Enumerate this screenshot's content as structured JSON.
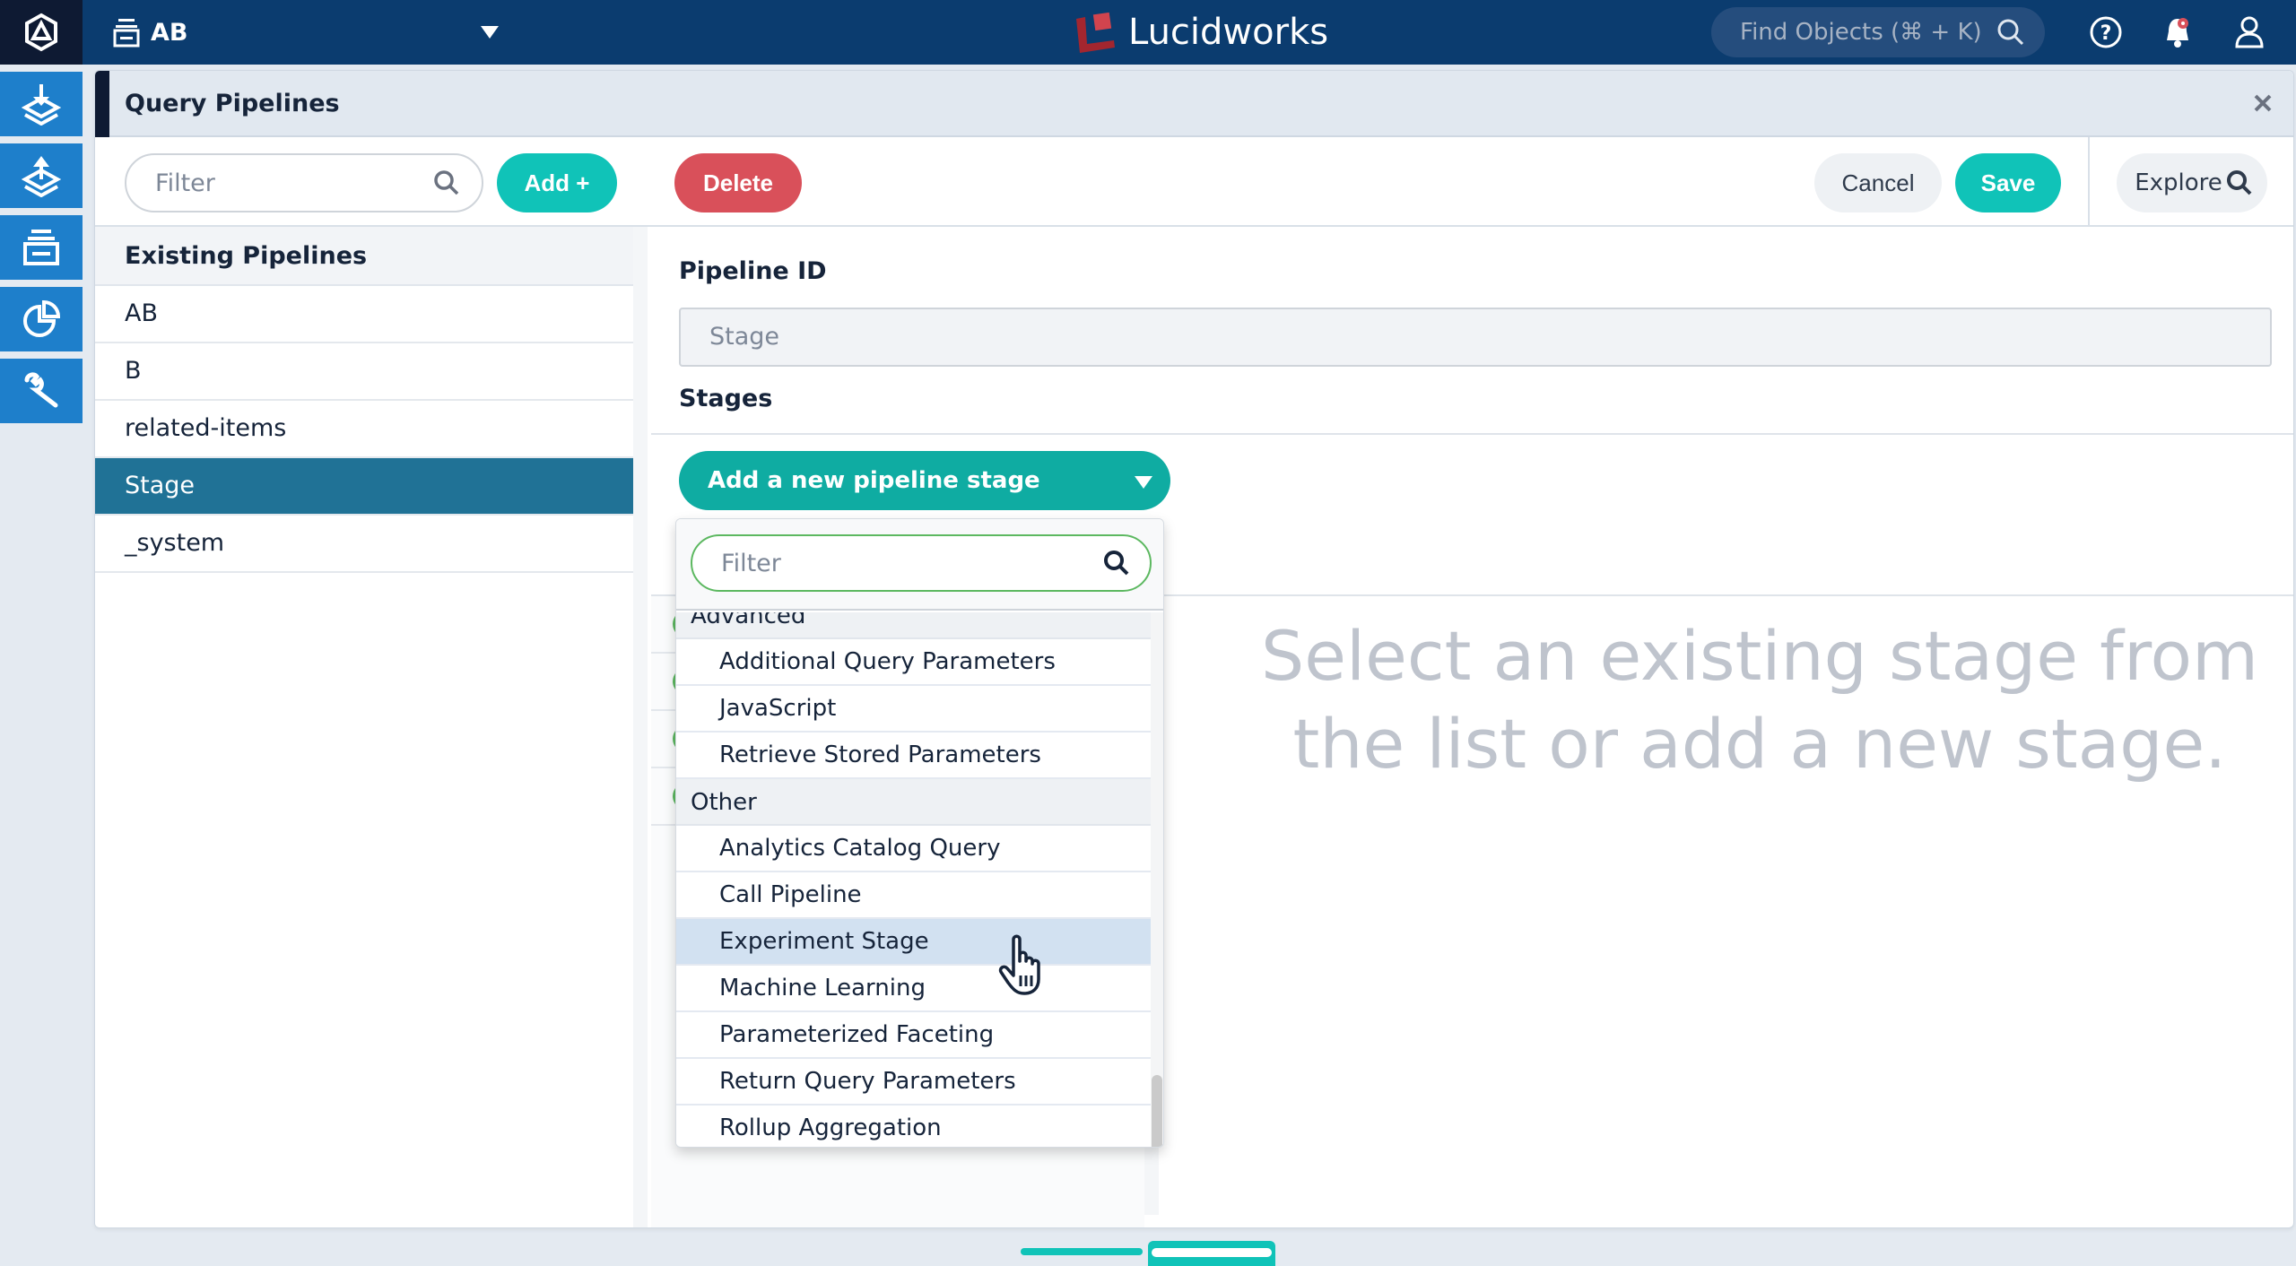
{
  "topnav": {
    "app_name": "AB",
    "brand": "Lucidworks",
    "find_placeholder": "Find Objects (⌘ + K)",
    "colors": {
      "nav_bg": "#0b3c6f",
      "brand_red": "#a3262f"
    }
  },
  "rail": {
    "items": [
      {
        "icon": "index-ingest-icon",
        "label": "Indexing"
      },
      {
        "icon": "query-pipeline-icon",
        "label": "Querying"
      },
      {
        "icon": "collections-icon",
        "label": "Collections"
      },
      {
        "icon": "analytics-icon",
        "label": "Analytics"
      },
      {
        "icon": "system-wrench-icon",
        "label": "System"
      }
    ]
  },
  "panel": {
    "title": "Query Pipelines",
    "toolbar": {
      "filter_placeholder": "Filter",
      "add_label": "Add +",
      "delete_label": "Delete",
      "cancel_label": "Cancel",
      "save_label": "Save",
      "explore_label": "Explore"
    },
    "list": {
      "header": "Existing Pipelines",
      "items": [
        "AB",
        "B",
        "related-items",
        "Stage",
        "_system"
      ],
      "selected": "Stage"
    },
    "form": {
      "pipeline_id_label": "Pipeline ID",
      "pipeline_id_value": "Stage",
      "stages_label": "Stages",
      "add_stage_label": "Add a new pipeline stage",
      "empty_message": "Select an existing stage from the list or add a new stage."
    },
    "dropdown": {
      "filter_placeholder": "Filter",
      "groups": [
        {
          "name": "Advanced",
          "items": [
            "Additional Query Parameters",
            "JavaScript",
            "Retrieve Stored Parameters"
          ]
        },
        {
          "name": "Other",
          "items": [
            "Analytics Catalog Query",
            "Call Pipeline",
            "Experiment Stage",
            "Machine Learning",
            "Parameterized Faceting",
            "Return Query Parameters",
            "Rollup Aggregation"
          ]
        }
      ],
      "hovered_item": "Experiment Stage"
    }
  },
  "colors": {
    "accent_teal": "#10c3b8",
    "delete_red": "#d9505a",
    "selected_row": "#207296",
    "rail_blue": "#1e7fcb",
    "hover_row": "#d2e1f1",
    "stage_status_green": "#5cb860"
  },
  "pager": {
    "pages": 2,
    "current": 2
  }
}
